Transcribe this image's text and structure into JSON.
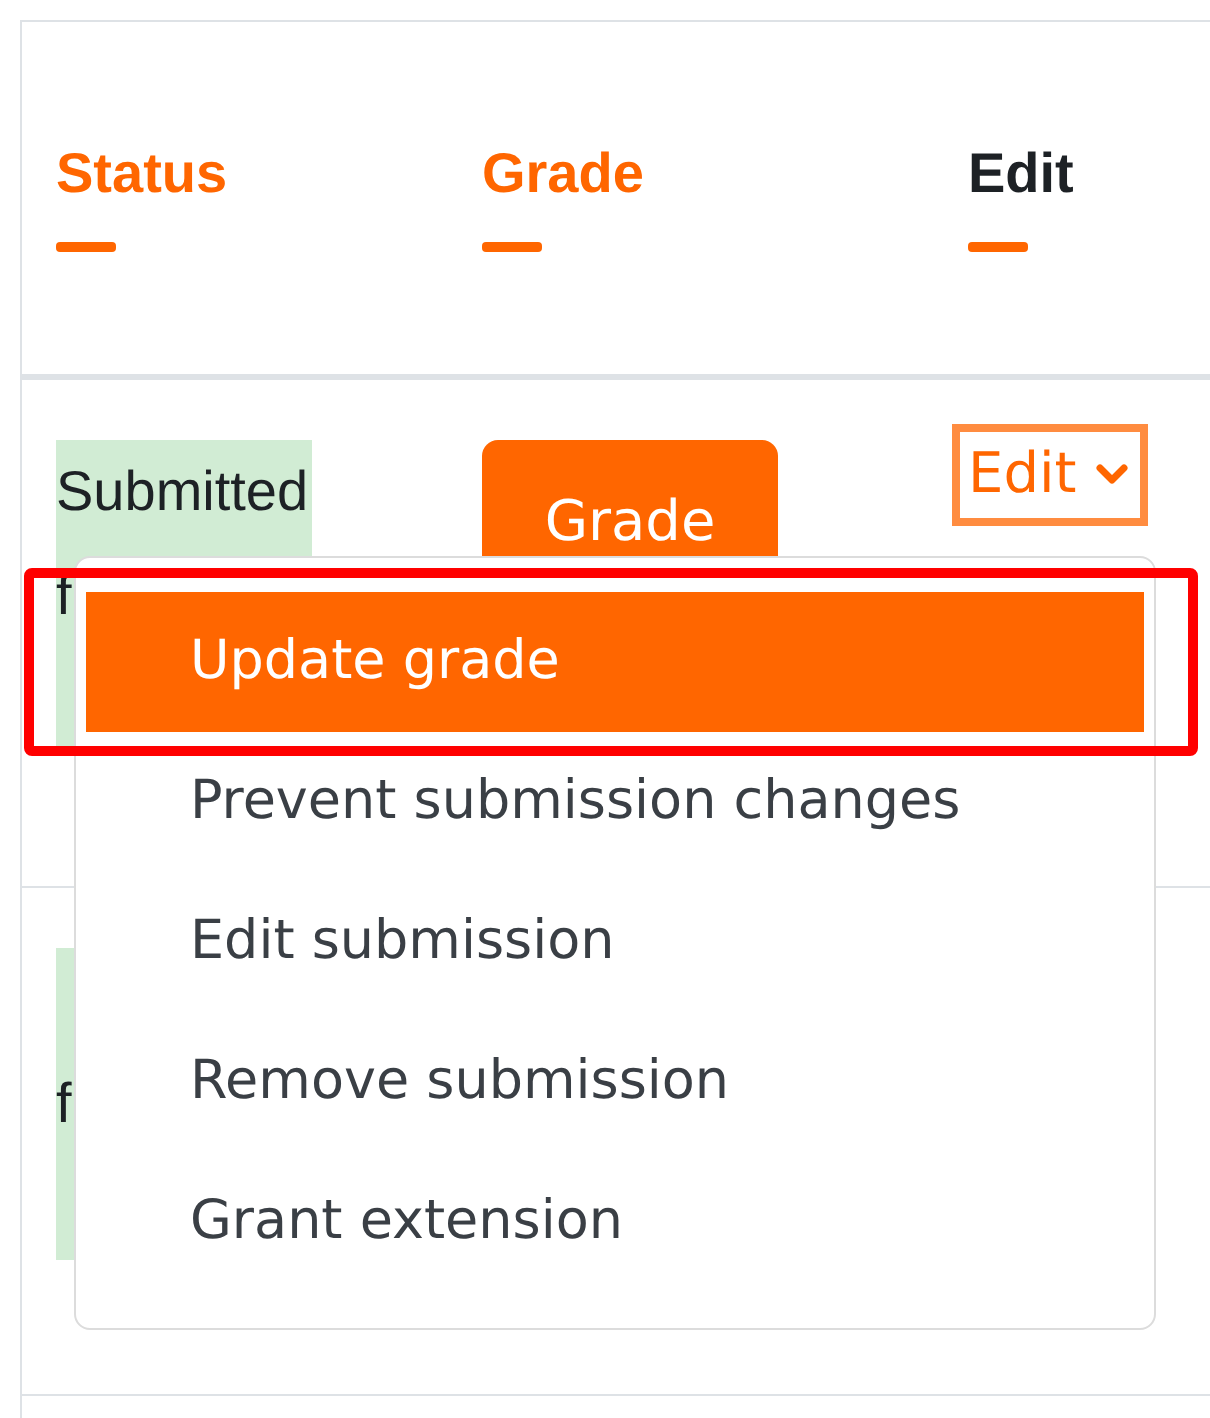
{
  "table": {
    "columns": [
      {
        "label": "Status",
        "sortable": true
      },
      {
        "label": "Grade",
        "sortable": true
      },
      {
        "label": "Edit",
        "sortable": false
      }
    ],
    "rows": [
      {
        "status_lines": [
          "Submitted",
          "f"
        ],
        "grade_button": "Grade",
        "edit_select": {
          "label": "Edit",
          "focused": true
        }
      },
      {
        "status_lines": [
          "f"
        ]
      }
    ]
  },
  "dropdown_menu": {
    "items": [
      {
        "label": "Update grade",
        "selected": true,
        "annotated": true
      },
      {
        "label": "Prevent submission changes",
        "selected": false,
        "annotated": false
      },
      {
        "label": "Edit submission",
        "selected": false,
        "annotated": false
      },
      {
        "label": "Remove submission",
        "selected": false,
        "annotated": false
      },
      {
        "label": "Grant extension",
        "selected": false,
        "annotated": false
      }
    ]
  }
}
